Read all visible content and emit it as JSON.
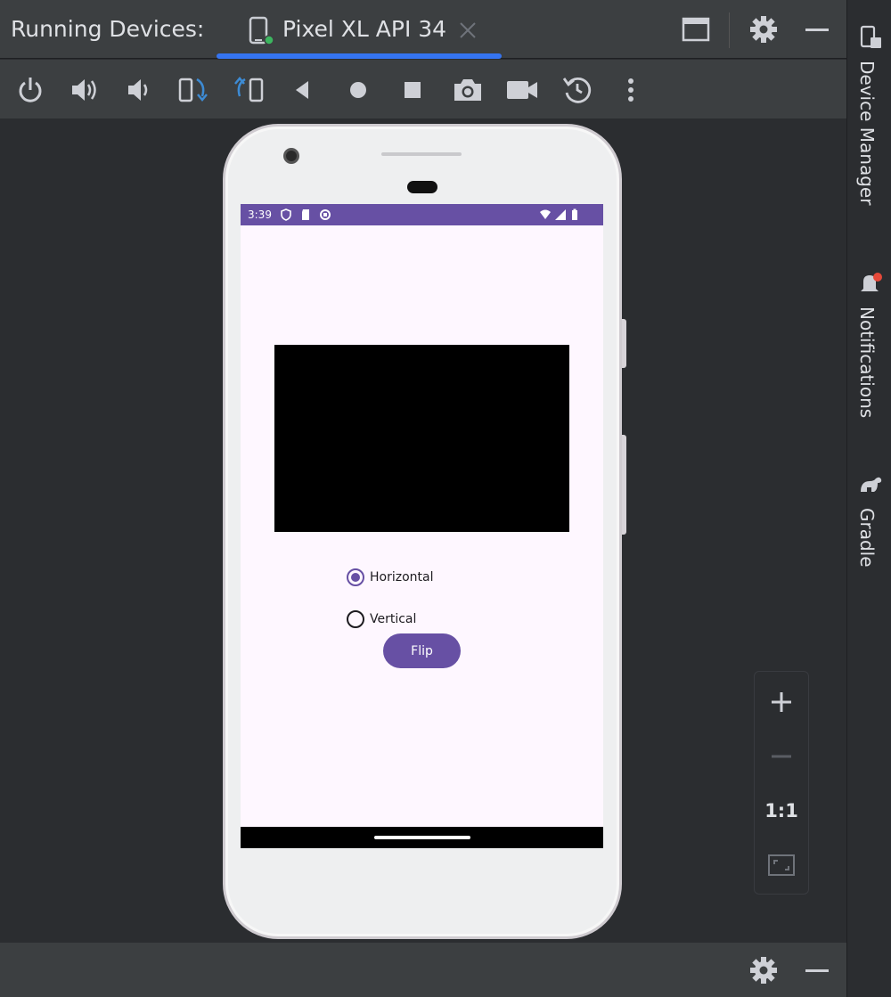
{
  "header": {
    "title": "Running Devices:",
    "tab_label": "Pixel XL API 34"
  },
  "toolbar": {
    "buttons": [
      "power-icon",
      "volume-up-icon",
      "volume-down-icon",
      "rotate-left-icon",
      "rotate-right-icon",
      "back-icon",
      "home-icon",
      "overview-icon",
      "screenshot-icon",
      "screen-record-icon",
      "snapshot-icon",
      "more-icon"
    ]
  },
  "device": {
    "status_time": "3:39",
    "app": {
      "radio_horizontal": "Horizontal",
      "radio_vertical": "Vertical",
      "selected": "Horizontal",
      "flip_label": "Flip"
    }
  },
  "zoom": {
    "one_to_one": "1:1"
  },
  "sidebar": {
    "items": [
      {
        "label": "Device Manager",
        "icon": "device-manager-icon"
      },
      {
        "label": "Notifications",
        "icon": "bell-icon"
      },
      {
        "label": "Gradle",
        "icon": "gradle-icon"
      }
    ]
  },
  "colors": {
    "accent": "#3574f0",
    "app_primary": "#6750a4",
    "screen_bg": "#fef7ff",
    "ide_bg": "#2b2d30",
    "toolbar_bg": "#3c3f41"
  }
}
